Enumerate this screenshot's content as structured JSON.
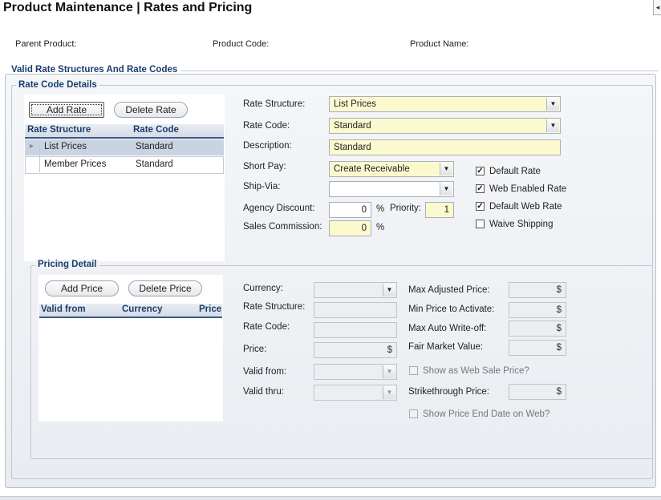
{
  "page": {
    "title": "Product Maintenance  |  Rates and Pricing",
    "corner_tab": "◂"
  },
  "header": {
    "parent_product_label": "Parent Product:",
    "product_code_label": "Product Code:",
    "product_name_label": "Product Name:"
  },
  "sections": {
    "valid_rates": "Valid Rate Structures And Rate Codes",
    "rate_code_details": "Rate Code Details",
    "pricing_detail": "Pricing Detail"
  },
  "rate_grid": {
    "add_label": "Add Rate",
    "delete_label": "Delete Rate",
    "columns": [
      "Rate Structure",
      "Rate Code"
    ],
    "rows": [
      {
        "structure": "List Prices",
        "code": "Standard",
        "selected": true
      },
      {
        "structure": "Member Prices",
        "code": "Standard",
        "selected": false
      }
    ]
  },
  "rate_form": {
    "rate_structure": {
      "label": "Rate Structure:",
      "value": "List Prices"
    },
    "rate_code": {
      "label": "Rate Code:",
      "value": "Standard"
    },
    "description": {
      "label": "Description:",
      "value": "Standard"
    },
    "short_pay": {
      "label": "Short Pay:",
      "value": "Create Receivable"
    },
    "ship_via": {
      "label": "Ship-Via:",
      "value": ""
    },
    "agency_discount": {
      "label": "Agency Discount:",
      "value": "0",
      "unit": "%"
    },
    "priority": {
      "label": "Priority:",
      "value": "1"
    },
    "sales_commission": {
      "label": "Sales Commission:",
      "value": "0",
      "unit": "%"
    },
    "checkboxes": [
      {
        "label": "Default Rate",
        "checked": true
      },
      {
        "label": "Web Enabled Rate",
        "checked": true
      },
      {
        "label": "Default Web Rate",
        "checked": true
      },
      {
        "label": "Waive Shipping",
        "checked": false
      }
    ]
  },
  "price_grid": {
    "add_label": "Add Price",
    "delete_label": "Delete Price",
    "columns": [
      "Valid from",
      "Currency",
      "Price"
    ]
  },
  "pricing_form": {
    "currency_label": "Currency:",
    "rate_structure_label": "Rate Structure:",
    "rate_code_label": "Rate Code:",
    "price_label": "Price:",
    "valid_from_label": "Valid from:",
    "valid_thru_label": "Valid thru:",
    "max_adjusted_label": "Max Adjusted Price:",
    "min_activate_label": "Min Price to Activate:",
    "max_writeoff_label": "Max Auto Write-off:",
    "fair_market_label": "Fair Market Value:",
    "show_web_sale_label": "Show as Web Sale Price?",
    "strikethrough_label": "Strikethrough Price:",
    "show_end_date_label": "Show Price End Date on Web?",
    "currency_symbol": "$"
  },
  "icons": {
    "dropdown": "▼",
    "row_pointer": "▸",
    "check": "✓"
  }
}
